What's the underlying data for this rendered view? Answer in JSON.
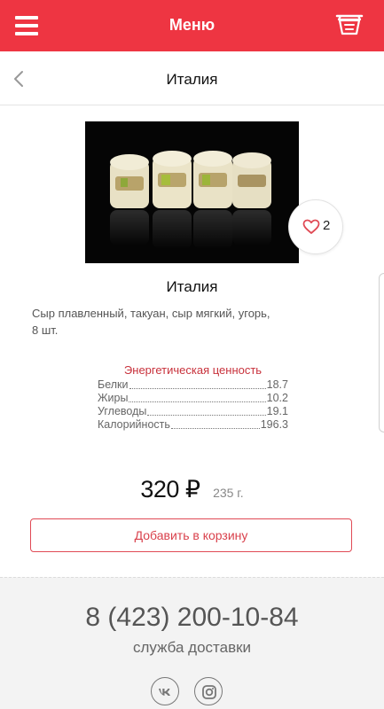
{
  "topbar": {
    "title": "Меню",
    "menu_icon": "hamburger-icon",
    "cart_icon": "cart-icon"
  },
  "subheader": {
    "title": "Италия",
    "back_icon": "chevron-left-icon"
  },
  "product": {
    "name": "Италия",
    "description": "Сыр плавленный, такуан, сыр мягкий, угорь, 8 шт.",
    "likes": "2",
    "price": "320 ₽",
    "weight": "235 г.",
    "add_to_cart": "Добавить в корзину"
  },
  "energy": {
    "title": "Энергетическая ценность",
    "rows": [
      {
        "label": "Белки",
        "value": "18.7"
      },
      {
        "label": "Жиры",
        "value": "10.2"
      },
      {
        "label": "Углеводы",
        "value": "19.1"
      },
      {
        "label": "Калорийность",
        "value": "196.3"
      }
    ]
  },
  "footer": {
    "phone": "8 (423) 200-10-84",
    "service": "служба доставки",
    "social": [
      "vk-icon",
      "instagram-icon"
    ]
  },
  "colors": {
    "accent": "#ee3542",
    "accent_text": "#d9414c",
    "footer_bg": "#f3f3f3"
  }
}
